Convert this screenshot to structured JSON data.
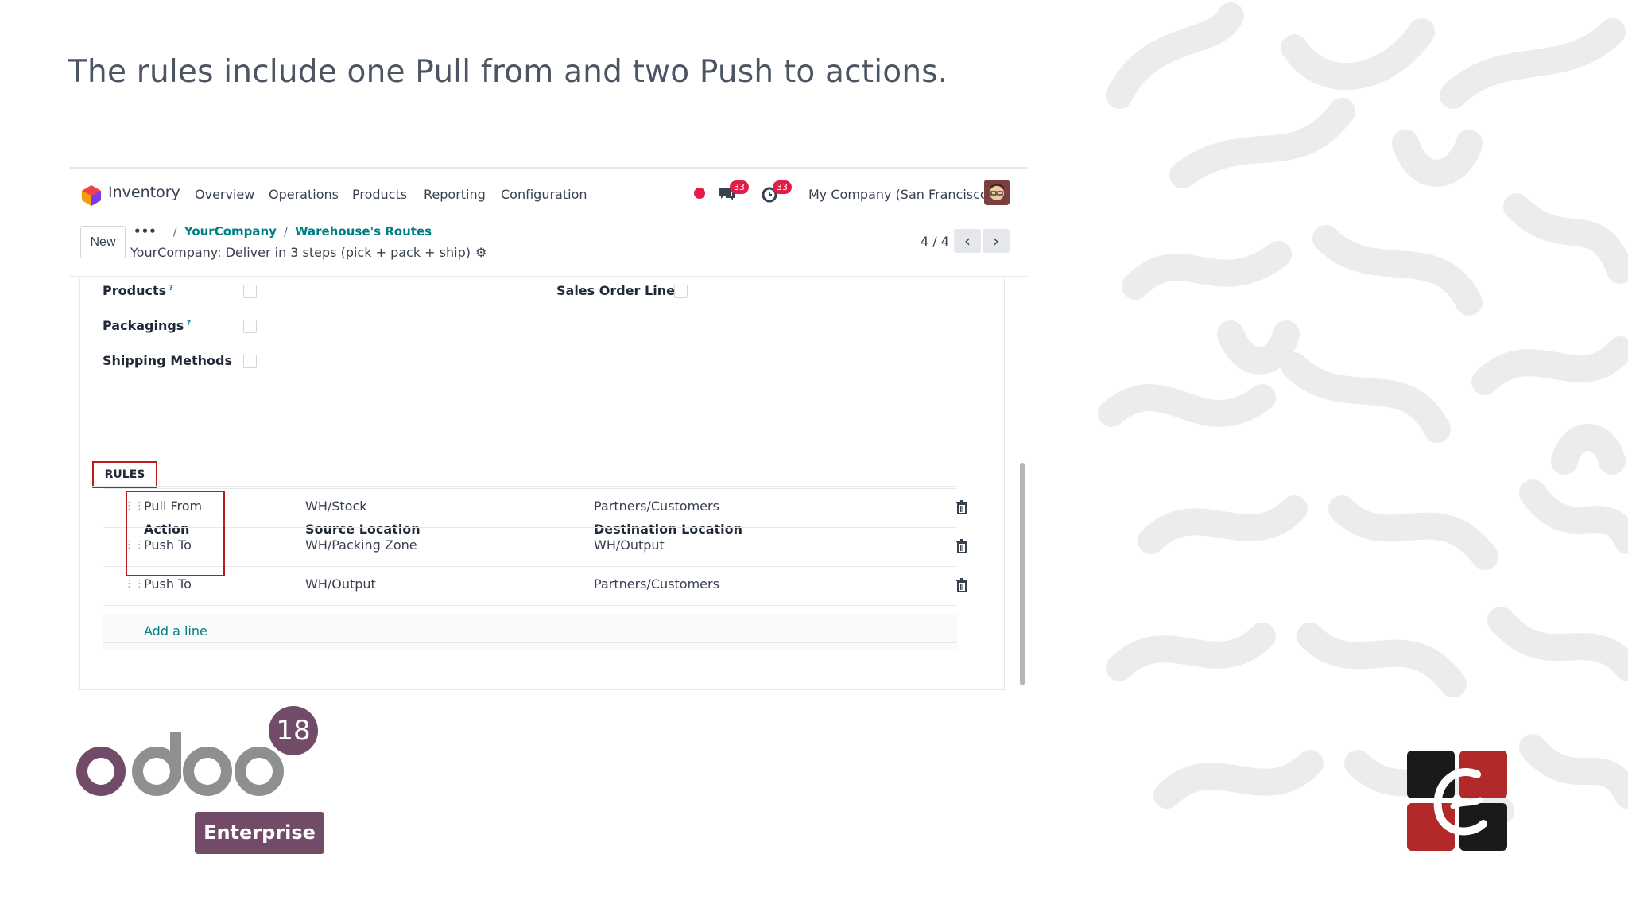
{
  "slide": {
    "title": "The rules include one Pull from and two Push to actions."
  },
  "navbar": {
    "app_name": "Inventory",
    "menu": [
      "Overview",
      "Operations",
      "Products",
      "Reporting",
      "Configuration"
    ],
    "messages_badge": "33",
    "activities_badge": "33",
    "company": "My Company (San Francisco)"
  },
  "control": {
    "new_label": "New",
    "breadcrumb_dots": "•••",
    "breadcrumb": [
      "YourCompany",
      "Warehouse's Routes"
    ],
    "record_name": "YourCompany: Deliver in 3 steps (pick + pack + ship)",
    "pager": "4 / 4"
  },
  "form": {
    "fields": {
      "products": "Products",
      "packagings": "Packagings",
      "shipping_methods": "Shipping Methods",
      "sales_order_lines": "Sales Order Lines",
      "help_mark": "?"
    },
    "tab": "RULES",
    "columns": [
      "Action",
      "Source Location",
      "Destination Location"
    ],
    "rows": [
      {
        "action": "Pull From",
        "source": "WH/Stock",
        "destination": "Partners/Customers"
      },
      {
        "action": "Push To",
        "source": "WH/Packing Zone",
        "destination": "WH/Output"
      },
      {
        "action": "Push To",
        "source": "WH/Output",
        "destination": "Partners/Customers"
      }
    ],
    "add_line": "Add a line"
  },
  "branding": {
    "version": "18",
    "edition": "Enterprise"
  },
  "colors": {
    "accent": "#017e84",
    "brand": "#714b67",
    "highlight": "#b91c1c",
    "badge": "#e11d48"
  }
}
